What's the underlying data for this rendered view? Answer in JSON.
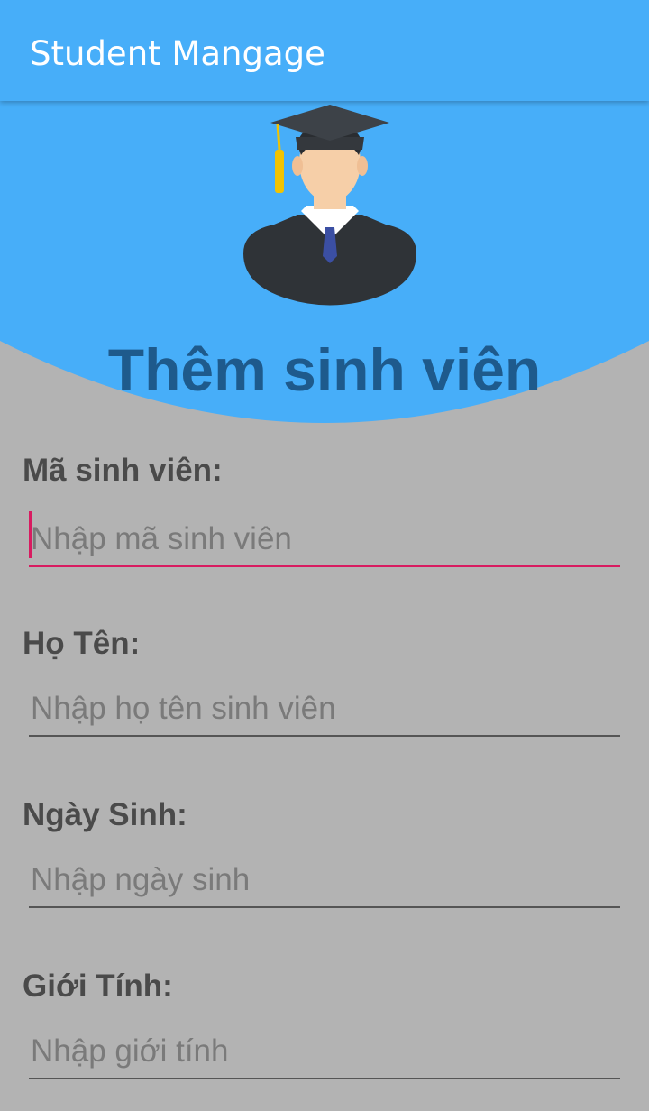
{
  "appbar": {
    "title": "Student Mangage",
    "color": "#47aef9"
  },
  "header": {
    "avatar_icon": "graduate-student-icon",
    "title": "Thêm sinh viên",
    "title_color": "#1e5a8c"
  },
  "form": {
    "fields": [
      {
        "label": "Mã sinh viên:",
        "placeholder": "Nhập mã sinh viên",
        "focused": true
      },
      {
        "label": "Họ Tên:",
        "placeholder": "Nhập họ tên sinh viên",
        "focused": false
      },
      {
        "label": "Ngày Sinh:",
        "placeholder": "Nhập ngày sinh",
        "focused": false
      },
      {
        "label": "Giới Tính:",
        "placeholder": "Nhập giới tính",
        "focused": false
      }
    ],
    "focus_color": "#d81b60",
    "background": "#b3b3b3"
  }
}
